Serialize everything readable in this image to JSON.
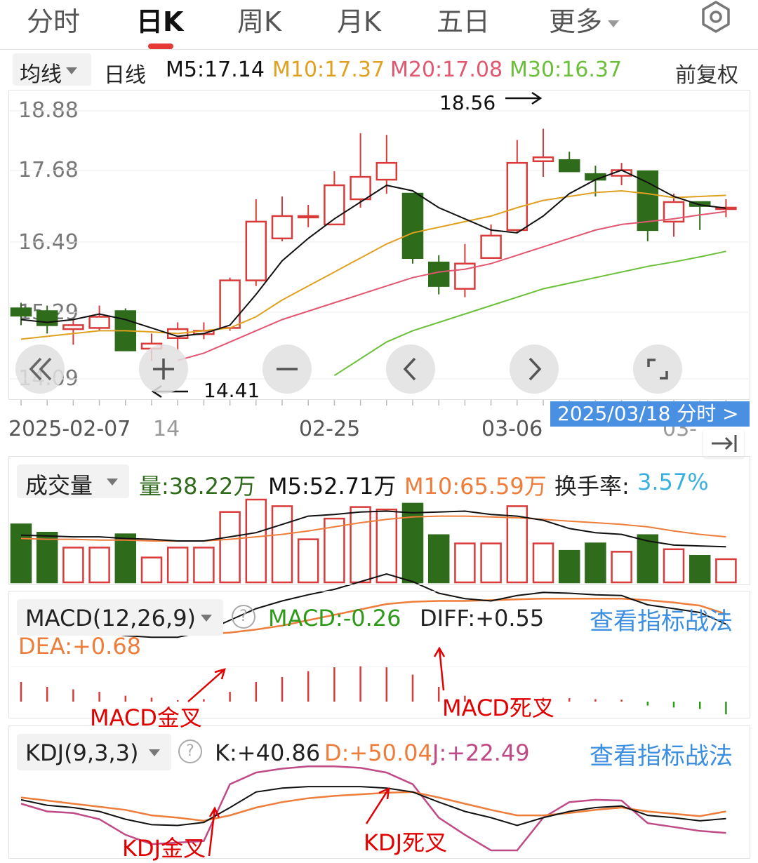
{
  "tabs": [
    "分时",
    "日K",
    "周K",
    "月K",
    "五日",
    "更多"
  ],
  "ma_bar": {
    "dropdown": "均线",
    "period": "日线",
    "m5": "M5:17.14",
    "m10": "M10:17.37",
    "m20": "M20:17.08",
    "m30": "M30:16.37",
    "adjust": "前复权"
  },
  "price_axis": [
    "18.88",
    "17.68",
    "16.49",
    "15.29",
    "14.09"
  ],
  "high_marker": "18.56",
  "low_marker": "14.41",
  "dates": [
    "2025-02-07",
    "14",
    "02-25",
    "03-06",
    "03-"
  ],
  "date_badge": "2025/03/18  分时  >",
  "volume_bar": {
    "dropdown": "成交量",
    "vol": "量:38.22万",
    "m5": "M5:52.71万",
    "m10": "M10:65.59万",
    "turnover_label": "换手率:",
    "turnover_value": "3.57%"
  },
  "macd_bar": {
    "dropdown": "MACD(12,26,9)",
    "macd": "MACD:-0.26",
    "diff": "DIFF:+0.55",
    "dea": "DEA:+0.68",
    "link": "查看指标战法"
  },
  "kdj_bar": {
    "dropdown": "KDJ(9,3,3)",
    "k": "K:+40.86",
    "d": "D:+50.04",
    "j": "J:+22.49",
    "link": "查看指标战法"
  },
  "annotations": {
    "macd_gold": "MACD金叉",
    "macd_dead": "MACD死叉",
    "kdj_gold": "KDJ金叉",
    "kdj_dead": "KDJ死叉"
  },
  "colors": {
    "up": "#d93a3a",
    "down": "#2e6b1a",
    "m5": "#111111",
    "m10": "#e0a020",
    "m20": "#e25670",
    "m30": "#6bbf3a",
    "dea": "#ee7d3b",
    "j": "#c04a86",
    "link": "#3b8ee0",
    "annotation": "#e00000"
  },
  "chart_data": {
    "type": "candlestick",
    "price_range": [
      14.09,
      18.88
    ],
    "candles": [
      {
        "o": 15.35,
        "c": 15.22,
        "h": 15.45,
        "l": 15.05
      },
      {
        "o": 15.3,
        "c": 15.05,
        "h": 15.4,
        "l": 14.9
      },
      {
        "o": 14.98,
        "c": 15.05,
        "h": 15.15,
        "l": 14.7
      },
      {
        "o": 15.0,
        "c": 15.2,
        "h": 15.4,
        "l": 14.95
      },
      {
        "o": 15.3,
        "c": 14.6,
        "h": 15.35,
        "l": 14.6
      },
      {
        "o": 14.63,
        "c": 14.72,
        "h": 14.9,
        "l": 14.41
      },
      {
        "o": 14.82,
        "c": 14.98,
        "h": 15.1,
        "l": 14.6
      },
      {
        "o": 14.89,
        "c": 14.95,
        "h": 15.1,
        "l": 14.8
      },
      {
        "o": 15.0,
        "c": 15.85,
        "h": 15.9,
        "l": 14.95
      },
      {
        "o": 15.85,
        "c": 16.9,
        "h": 17.3,
        "l": 15.75
      },
      {
        "o": 16.6,
        "c": 17.0,
        "h": 17.35,
        "l": 16.55
      },
      {
        "o": 16.98,
        "c": 17.0,
        "h": 17.2,
        "l": 16.8
      },
      {
        "o": 16.85,
        "c": 17.55,
        "h": 17.8,
        "l": 16.85
      },
      {
        "o": 17.3,
        "c": 17.7,
        "h": 18.48,
        "l": 17.15
      },
      {
        "o": 17.65,
        "c": 17.95,
        "h": 18.45,
        "l": 17.4
      },
      {
        "o": 17.4,
        "c": 16.25,
        "h": 17.4,
        "l": 16.15
      },
      {
        "o": 16.17,
        "c": 15.75,
        "h": 16.3,
        "l": 15.6
      },
      {
        "o": 15.7,
        "c": 16.15,
        "h": 16.5,
        "l": 15.55
      },
      {
        "o": 16.25,
        "c": 16.65,
        "h": 16.85,
        "l": 16.25
      },
      {
        "o": 16.75,
        "c": 17.95,
        "h": 18.36,
        "l": 16.7
      },
      {
        "o": 17.98,
        "c": 18.05,
        "h": 18.56,
        "l": 17.7
      },
      {
        "o": 18.0,
        "c": 17.8,
        "h": 18.15,
        "l": 17.8
      },
      {
        "o": 17.75,
        "c": 17.65,
        "h": 17.9,
        "l": 17.35
      },
      {
        "o": 17.72,
        "c": 17.82,
        "h": 17.95,
        "l": 17.55
      },
      {
        "o": 17.8,
        "c": 16.75,
        "h": 17.8,
        "l": 16.55
      },
      {
        "o": 16.9,
        "c": 17.25,
        "h": 17.4,
        "l": 16.63
      },
      {
        "o": 17.25,
        "c": 17.18,
        "h": 17.25,
        "l": 16.75
      },
      {
        "o": 17.14,
        "c": 17.15,
        "h": 17.3,
        "l": 16.98
      }
    ],
    "ma5": [
      15.15,
      15.1,
      15.15,
      15.25,
      15.15,
      15.0,
      14.85,
      14.9,
      15.05,
      15.6,
      16.2,
      16.6,
      16.95,
      17.25,
      17.55,
      17.45,
      17.15,
      16.95,
      16.75,
      16.7,
      17.0,
      17.4,
      17.65,
      17.82,
      17.6,
      17.35,
      17.2,
      17.14
    ],
    "ma10": [
      14.8,
      14.85,
      14.9,
      14.95,
      14.95,
      14.93,
      14.9,
      14.95,
      15.0,
      15.2,
      15.5,
      15.75,
      16.0,
      16.25,
      16.5,
      16.7,
      16.8,
      16.9,
      17.0,
      17.15,
      17.28,
      17.35,
      17.42,
      17.45,
      17.4,
      17.33,
      17.35,
      17.37
    ],
    "ma20": [
      null,
      null,
      null,
      null,
      null,
      null,
      14.42,
      14.55,
      14.75,
      14.95,
      15.15,
      15.3,
      15.45,
      15.6,
      15.75,
      15.9,
      16.0,
      16.05,
      16.15,
      16.3,
      16.45,
      16.6,
      16.75,
      16.85,
      16.9,
      16.95,
      17.02,
      17.08
    ],
    "ma30": [
      null,
      null,
      null,
      null,
      null,
      null,
      null,
      null,
      null,
      null,
      null,
      null,
      14.15,
      14.45,
      14.75,
      14.95,
      15.1,
      15.25,
      15.4,
      15.55,
      15.7,
      15.8,
      15.9,
      16.0,
      16.1,
      16.18,
      16.27,
      16.37
    ],
    "volume": [
      0.7,
      0.6,
      0.42,
      0.42,
      0.58,
      0.3,
      0.42,
      0.42,
      0.85,
      1.0,
      0.92,
      0.52,
      0.77,
      0.91,
      0.88,
      0.95,
      0.57,
      0.47,
      0.47,
      0.92,
      0.47,
      0.38,
      0.47,
      0.37,
      0.57,
      0.4,
      0.32,
      0.28
    ],
    "vol_m5": [
      0.57,
      0.56,
      0.55,
      0.55,
      0.53,
      0.52,
      0.5,
      0.5,
      0.55,
      0.6,
      0.7,
      0.8,
      0.82,
      0.85,
      0.86,
      0.84,
      0.85,
      0.86,
      0.82,
      0.8,
      0.75,
      0.65,
      0.6,
      0.58,
      0.5,
      0.45,
      0.44,
      0.43
    ],
    "vol_m10": [
      0.53,
      0.52,
      0.52,
      0.51,
      0.51,
      0.5,
      0.5,
      0.5,
      0.52,
      0.55,
      0.58,
      0.62,
      0.67,
      0.72,
      0.76,
      0.79,
      0.8,
      0.8,
      0.79,
      0.78,
      0.76,
      0.74,
      0.72,
      0.7,
      0.67,
      0.62,
      0.58,
      0.55
    ],
    "macd_diff": [
      0.7,
      0.62,
      0.55,
      0.45,
      0.4,
      0.38,
      0.38,
      0.45,
      0.6,
      0.75,
      0.85,
      0.93,
      1.0,
      1.1,
      1.2,
      1.1,
      0.95,
      0.88,
      0.85,
      0.92,
      0.96,
      0.95,
      0.93,
      0.92,
      0.8,
      0.75,
      0.7,
      0.55
    ],
    "macd_dea": [
      0.5,
      0.5,
      0.48,
      0.45,
      0.43,
      0.42,
      0.42,
      0.42,
      0.44,
      0.48,
      0.53,
      0.6,
      0.67,
      0.74,
      0.81,
      0.84,
      0.85,
      0.85,
      0.86,
      0.87,
      0.88,
      0.88,
      0.88,
      0.88,
      0.86,
      0.83,
      0.79,
      0.68
    ],
    "macd_hist": [
      0.4,
      0.3,
      0.25,
      0.2,
      0.12,
      0.08,
      0.03,
      0.05,
      0.2,
      0.4,
      0.5,
      0.62,
      0.7,
      0.72,
      0.7,
      0.55,
      0.3,
      0.12,
      0.05,
      0.06,
      0.08,
      0.07,
      0.05,
      0.04,
      -0.08,
      -0.12,
      -0.15,
      -0.26
    ],
    "kdj_k": [
      65,
      58,
      55,
      50,
      40,
      33,
      32,
      36,
      55,
      75,
      80,
      82,
      82,
      82,
      80,
      75,
      62,
      50,
      42,
      32,
      42,
      50,
      55,
      57,
      45,
      42,
      38,
      40.86
    ],
    "kdj_d": [
      68,
      64,
      60,
      56,
      52,
      45,
      42,
      38,
      45,
      55,
      62,
      67,
      70,
      72,
      74,
      75,
      68,
      60,
      52,
      45,
      45,
      48,
      52,
      55,
      50,
      47,
      44,
      50.04
    ],
    "kdj_j": [
      60,
      50,
      48,
      40,
      20,
      8,
      10,
      12,
      85,
      100,
      105,
      108,
      108,
      106,
      100,
      85,
      42,
      20,
      0,
      0,
      42,
      62,
      65,
      64,
      35,
      30,
      25,
      22.49
    ]
  }
}
